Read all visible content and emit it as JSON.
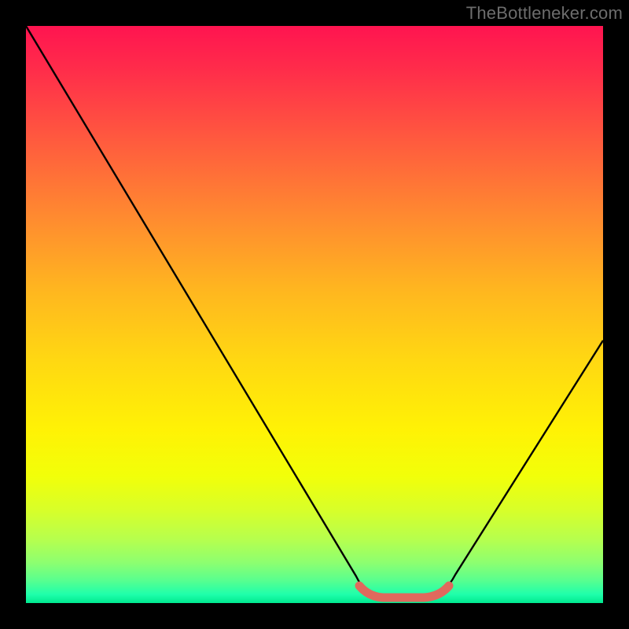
{
  "watermark": "TheBottleneker.com",
  "chart_data": {
    "type": "line",
    "title": "",
    "xlabel": "",
    "ylabel": "",
    "xlim": [
      0,
      100
    ],
    "ylim": [
      0,
      100
    ],
    "background_gradient": {
      "top_color": "#ff1450",
      "mid_color": "#fff205",
      "bottom_color": "#00e98f"
    },
    "series": [
      {
        "name": "bottleneck-curve",
        "x": [
          0,
          10,
          20,
          30,
          40,
          50,
          56,
          60,
          64,
          68,
          72,
          80,
          90,
          100
        ],
        "y": [
          100,
          82,
          64,
          46,
          28,
          12,
          3,
          0,
          0,
          0,
          3,
          12,
          28,
          45
        ]
      }
    ],
    "marker": {
      "name": "optimal-range",
      "x_start": 57,
      "x_end": 71,
      "y": 0.6,
      "color": "#e0695d"
    },
    "colors": {
      "curve": "#000000",
      "marker": "#e0695d"
    }
  }
}
